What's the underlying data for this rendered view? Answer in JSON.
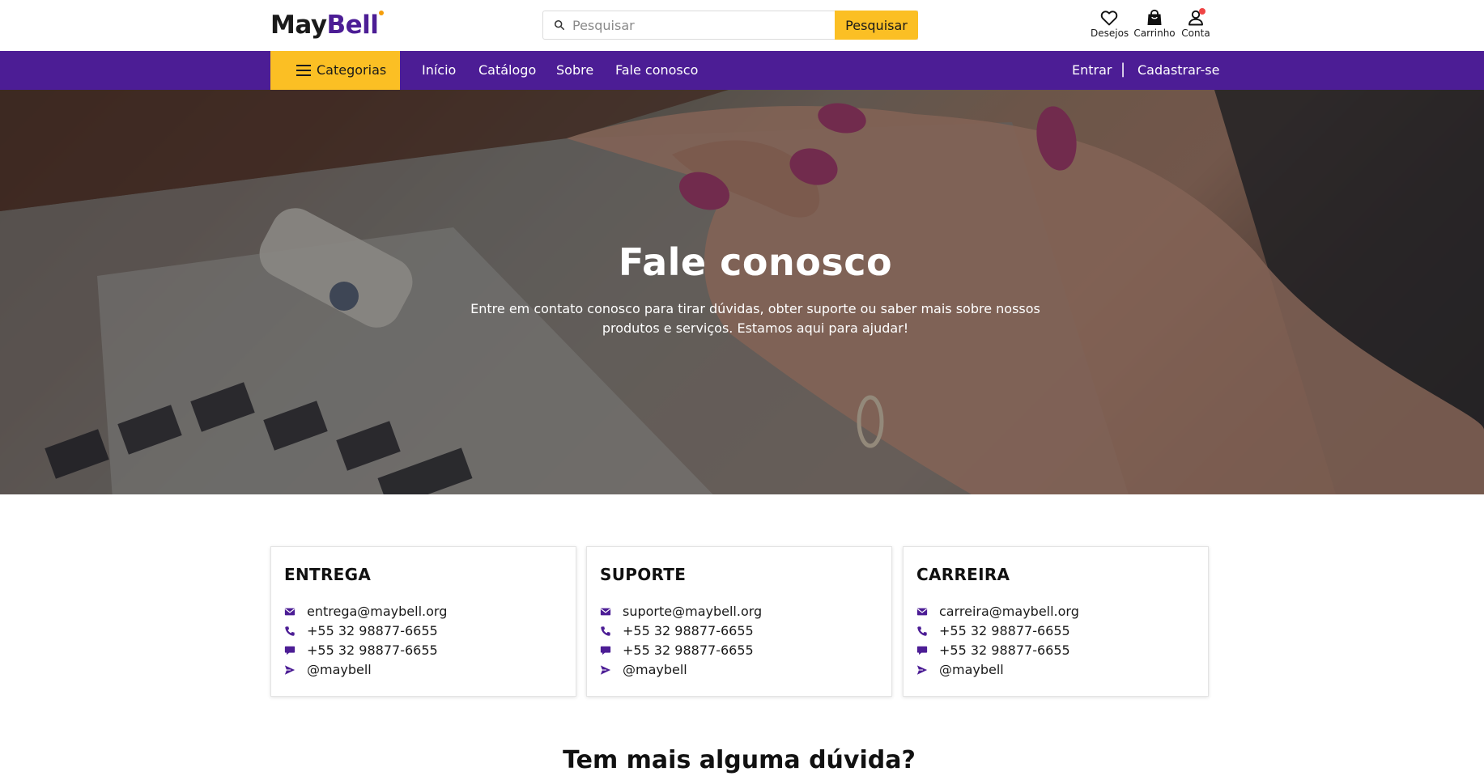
{
  "brand": {
    "part1": "May",
    "part2": "Bell",
    "dot_color": "#f59e0b"
  },
  "search": {
    "placeholder": "Pesquisar",
    "button_label": "Pesquisar"
  },
  "header_icons": {
    "wishlist": "Desejos",
    "cart": "Carrinho",
    "account": "Conta"
  },
  "nav": {
    "categories_label": "Categorias",
    "links": [
      "Início",
      "Catálogo",
      "Sobre",
      "Fale conosco"
    ],
    "login": "Entrar",
    "separator": "|",
    "register": "Cadastrar-se"
  },
  "hero": {
    "title": "Fale conosco",
    "description": "Entre em contato conosco para tirar dúvidas, obter suporte ou saber mais sobre nossos produtos e serviços. Estamos aqui para ajudar!"
  },
  "cards": [
    {
      "title": "ENTREGA",
      "email": "entrega@maybell.org",
      "phone": "+55 32 98877-6655",
      "chat": "+55 32 98877-6655",
      "telegram": "@maybell"
    },
    {
      "title": "SUPORTE",
      "email": "suporte@maybell.org",
      "phone": "+55 32 98877-6655",
      "chat": "+55 32 98877-6655",
      "telegram": "@maybell"
    },
    {
      "title": "CARREIRA",
      "email": "carreira@maybell.org",
      "phone": "+55 32 98877-6655",
      "chat": "+55 32 98877-6655",
      "telegram": "@maybell"
    }
  ],
  "section_heading": "Tem mais alguma dúvida?",
  "colors": {
    "primary": "#4c1d95",
    "accent": "#fbbf24",
    "notification": "#ef4444"
  },
  "icons": [
    "search-icon",
    "heart-icon",
    "shopping-bag-icon",
    "user-icon",
    "hamburger-icon",
    "envelope-icon",
    "phone-icon",
    "chat-bubble-icon",
    "send-icon"
  ]
}
